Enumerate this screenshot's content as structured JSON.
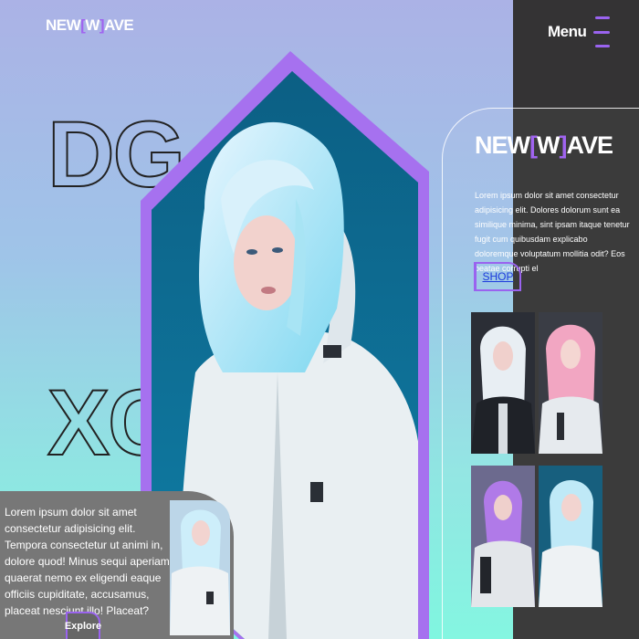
{
  "header": {
    "logo_prefix": "NEW",
    "logo_bracket_open": "[",
    "logo_w": "W",
    "logo_bracket_close": "]",
    "logo_suffix": "AVE",
    "menu_label": "Menu"
  },
  "hero": {
    "outline_line1": "DG",
    "outline_line2": "XC"
  },
  "right_card": {
    "logo_prefix": "NEW",
    "logo_bracket_open": "[",
    "logo_w": "W",
    "logo_bracket_close": "]",
    "logo_suffix": "AVE",
    "description": "Lorem ipsum dolor sit amet consectetur adipisicing elit. Dolores dolorum sunt ea similique minima, sint ipsam itaque tenetur fugit cum quibusdam explicabo doloremque voluptatum mollitia odit? Eos beatae corrupti el",
    "shop_label": "SHOP"
  },
  "bottom_card": {
    "text": "Lorem ipsum dolor sit amet consectetur adipisicing elit. Tempora consectetur ut animi in, dolore quod! Minus sequi aperiam quaerat nemo ex eligendi eaque officiis cupiditate, accusamus, placeat nesciunt illo! Placeat?",
    "explore_label": "Explore"
  },
  "colors": {
    "accent": "#9a63ef",
    "dark_panel": "#343334",
    "gradient_top": "#abb2e6",
    "gradient_bottom": "#80f6e0",
    "link": "#1c3bdc"
  },
  "icons": [
    "hamburger-menu-icon"
  ]
}
